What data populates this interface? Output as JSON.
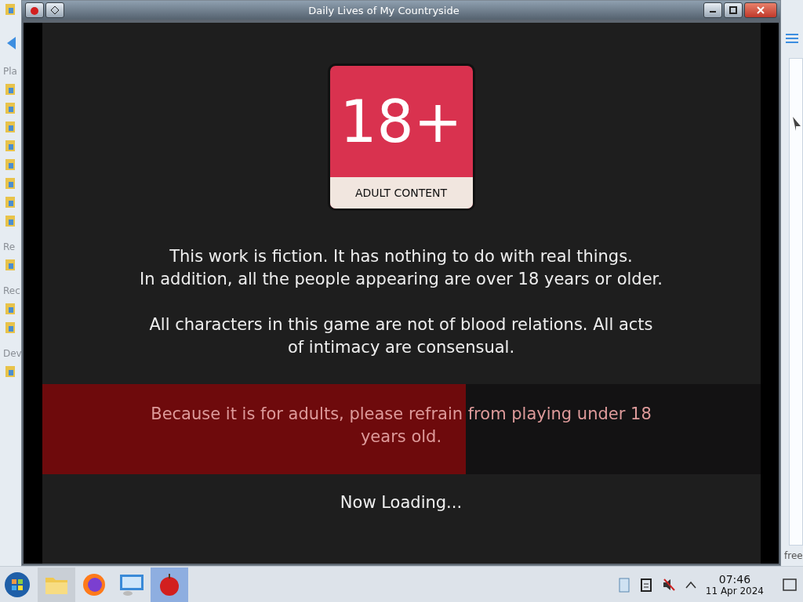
{
  "window": {
    "title": "Daily Lives of My Countryside"
  },
  "background_window": {
    "sidebar_headings": [
      "Pla",
      "Re",
      "Rec",
      "Dev"
    ],
    "status_text": "free"
  },
  "rating_badge": {
    "rating": "18+",
    "label": "ADULT CONTENT"
  },
  "notice": [
    "This work is fiction. It has nothing to do with real things.\nIn addition, all the people appearing are over 18 years or older.",
    "All characters in this game are not of blood relations. All acts\nof intimacy are consensual."
  ],
  "loading": {
    "level": 0.59,
    "message": "Because it is for adults, please refrain from playing under 18\nyears old.",
    "status": "Now Loading..."
  },
  "taskbar": {
    "apps": [
      {
        "kind": "folder",
        "running": true,
        "selected": false
      },
      {
        "kind": "browser",
        "running": false,
        "selected": false
      },
      {
        "kind": "monitor",
        "running": false,
        "selected": false
      },
      {
        "kind": "apple",
        "running": true,
        "selected": true
      }
    ],
    "clock": {
      "time": "07:46",
      "date": "11 Apr 2024"
    }
  }
}
